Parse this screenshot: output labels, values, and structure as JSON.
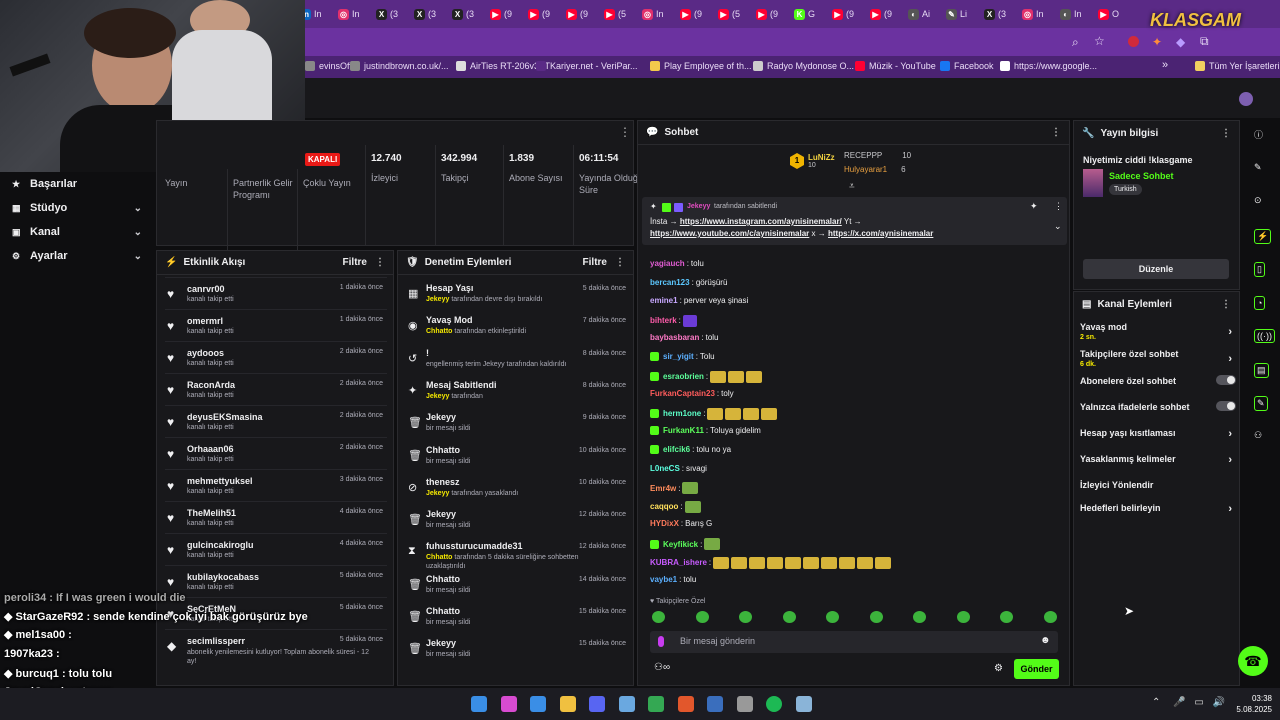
{
  "browser": {
    "tabs": [
      {
        "label": "In",
        "color": "#0a66c2",
        "glyph": "in"
      },
      {
        "label": "In",
        "color": "#e1306c",
        "glyph": "◎"
      },
      {
        "label": "(3",
        "color": "#222",
        "glyph": "X"
      },
      {
        "label": "(3",
        "color": "#222",
        "glyph": "X"
      },
      {
        "label": "(3",
        "color": "#222",
        "glyph": "X"
      },
      {
        "label": "(9",
        "color": "#ff0033",
        "glyph": "▶"
      },
      {
        "label": "(9",
        "color": "#ff0033",
        "glyph": "▶"
      },
      {
        "label": "(9",
        "color": "#ff0033",
        "glyph": "▶"
      },
      {
        "label": "(5",
        "color": "#ff0033",
        "glyph": "▶"
      },
      {
        "label": "In",
        "color": "#e1306c",
        "glyph": "◎"
      },
      {
        "label": "(9",
        "color": "#ff0033",
        "glyph": "▶"
      },
      {
        "label": "(5",
        "color": "#ff0033",
        "glyph": "▶"
      },
      {
        "label": "(9",
        "color": "#ff0033",
        "glyph": "▶"
      },
      {
        "label": "G",
        "color": "#53fc18",
        "glyph": "K"
      },
      {
        "label": "(9",
        "color": "#ff0033",
        "glyph": "▶"
      },
      {
        "label": "(9",
        "color": "#ff0033",
        "glyph": "▶"
      },
      {
        "label": "Ai",
        "color": "#555",
        "glyph": "◐"
      },
      {
        "label": "Li",
        "color": "#555",
        "glyph": "✎"
      },
      {
        "label": "(3",
        "color": "#222",
        "glyph": "X"
      },
      {
        "label": "In",
        "color": "#e1306c",
        "glyph": "◎"
      },
      {
        "label": "In",
        "color": "#555",
        "glyph": "◐"
      },
      {
        "label": "O",
        "color": "#ff0033",
        "glyph": "▶"
      }
    ],
    "bookmarks": [
      {
        "label": "evinsOff...",
        "color": "#888"
      },
      {
        "label": "justindbrown.co.uk/...",
        "color": "#888"
      },
      {
        "label": "AirTies RT-206v3TT",
        "color": "#ddd"
      },
      {
        "label": "Kariyer.net - VeriPar...",
        "color": "#5a2a86"
      },
      {
        "label": "Play Employee of th...",
        "color": "#f2c94c"
      },
      {
        "label": "Radyo Mydonose O...",
        "color": "#ccc"
      },
      {
        "label": "Müzik - YouTube",
        "color": "#ff0033"
      },
      {
        "label": "Facebook",
        "color": "#1877f2"
      },
      {
        "label": "https://www.google...",
        "color": "#fff"
      },
      {
        "label": "Tüm Yer İşaretleri",
        "color": "#f0d060"
      }
    ],
    "overflow": "»",
    "logo": "KLASGAM"
  },
  "leftnav": {
    "items": [
      {
        "label": "Başarılar",
        "icon": "star-icon",
        "chev": ""
      },
      {
        "label": "Stüdyo",
        "icon": "studio-icon",
        "chev": "⌄"
      },
      {
        "label": "Kanal",
        "icon": "channel-icon",
        "chev": "⌄"
      },
      {
        "label": "Ayarlar",
        "icon": "gear-icon",
        "chev": "⌄"
      }
    ]
  },
  "overlay_chat": [
    {
      "text": "peroli34 : If I was green i would die",
      "color": "#aaa"
    },
    {
      "text": "◆ StarGazeR92 : sende kendine çok iyi bak görüşürüz bye",
      "color": "#fff"
    },
    {
      "text": "◆ mel1sa00 :",
      "color": "#fff"
    },
    {
      "text": "1907ka23 :",
      "color": "#fff"
    },
    {
      "text": "◆ burcuq1 : tolu tolu",
      "color": "#fff"
    },
    {
      "text": "JawelCrawl : wtcnnn",
      "color": "#fff"
    }
  ],
  "stats": {
    "status": "KAPALI",
    "items": [
      {
        "value": "",
        "label": "Yayın"
      },
      {
        "value": "",
        "label": "Partnerlik Gelir Programı"
      },
      {
        "value": "",
        "label": "Çoklu Yayın"
      },
      {
        "value": "12.740",
        "label": "İzleyici"
      },
      {
        "value": "342.994",
        "label": "Takipçi"
      },
      {
        "value": "1.839",
        "label": "Abone Sayısı"
      },
      {
        "value": "06:11:54",
        "label": "Yayında Olduğu Süre"
      }
    ]
  },
  "activity": {
    "title": "Etkinlik Akışı",
    "filter": "Filtre",
    "items": [
      {
        "name": "canrvr00",
        "sub": "kanalı takip etti",
        "time": "1 dakika önce"
      },
      {
        "name": "omermrl",
        "sub": "kanalı takip etti",
        "time": "1 dakika önce"
      },
      {
        "name": "aydooos",
        "sub": "kanalı takip etti",
        "time": "2 dakika önce"
      },
      {
        "name": "RaconArda",
        "sub": "kanalı takip etti",
        "time": "2 dakika önce"
      },
      {
        "name": "deyusEKSmasina",
        "sub": "kanalı takip etti",
        "time": "2 dakika önce"
      },
      {
        "name": "Orhaaan06",
        "sub": "kanalı takip etti",
        "time": "2 dakika önce"
      },
      {
        "name": "mehmettyuksel",
        "sub": "kanalı takip etti",
        "time": "3 dakika önce"
      },
      {
        "name": "TheMelih51",
        "sub": "kanalı takip etti",
        "time": "4 dakika önce"
      },
      {
        "name": "gulcincakiroglu",
        "sub": "kanalı takip etti",
        "time": "4 dakika önce"
      },
      {
        "name": "kubilaykocabass",
        "sub": "kanalı takip etti",
        "time": "5 dakika önce"
      },
      {
        "name": "SeCrEtMeN",
        "sub": "kanalı takip etti",
        "time": "5 dakika önce"
      },
      {
        "name": "secimlissperr",
        "sub": "abonelik yenilemesini kutluyor! Toplam abonelik süresi - 12 ay!",
        "time": "5 dakika önce"
      }
    ]
  },
  "moderation": {
    "title": "Denetim Eylemleri",
    "filter": "Filtre",
    "items": [
      {
        "icon": "calendar-icon",
        "glyph": "▦",
        "name": "Hesap Yaşı",
        "user": "Jekeyy",
        "sub": "tarafından devre dışı bırakıldı",
        "time": "5 dakika önce"
      },
      {
        "icon": "snail-icon",
        "glyph": "◉",
        "name": "Yavaş Mod",
        "user": "Chhatto",
        "sub": "tarafından etkinleştirildi",
        "time": "7 dakika önce"
      },
      {
        "icon": "undo-icon",
        "glyph": "↺",
        "name": "!",
        "user": "",
        "sub": "engellenmiş terim Jekeyy tarafından kaldırıldı",
        "time": "8 dakika önce"
      },
      {
        "icon": "pin-icon",
        "glyph": "✦",
        "name": "Mesaj Sabitlendi",
        "user": "Jekeyy",
        "sub": "tarafından",
        "time": "8 dakika önce"
      },
      {
        "icon": "trash-icon",
        "glyph": "🗑",
        "name": "Jekeyy",
        "user": "",
        "sub": "bir mesajı sildi",
        "time": "9 dakika önce"
      },
      {
        "icon": "trash-icon",
        "glyph": "🗑",
        "name": "Chhatto",
        "user": "",
        "sub": "bir mesajı sildi",
        "time": "10 dakika önce"
      },
      {
        "icon": "ban-icon",
        "glyph": "⊘",
        "name": "thenesz",
        "user": "Jekeyy",
        "sub": "tarafından yasaklandı",
        "time": "10 dakika önce"
      },
      {
        "icon": "trash-icon",
        "glyph": "🗑",
        "name": "Jekeyy",
        "user": "",
        "sub": "bir mesajı sildi",
        "time": "12 dakika önce"
      },
      {
        "icon": "timer-icon",
        "glyph": "⧗",
        "name": "fuhussturucumadde31",
        "user": "Chhatto",
        "sub": "tarafından 5 dakika süreliğine sohbetten uzaklaştırıldı",
        "time": "12 dakika önce"
      },
      {
        "icon": "trash-icon",
        "glyph": "🗑",
        "name": "Chhatto",
        "user": "",
        "sub": "bir mesajı sildi",
        "time": "14 dakika önce"
      },
      {
        "icon": "trash-icon",
        "glyph": "🗑",
        "name": "Chhatto",
        "user": "",
        "sub": "bir mesajı sildi",
        "time": "15 dakika önce"
      },
      {
        "icon": "trash-icon",
        "glyph": "🗑",
        "name": "Jekeyy",
        "user": "",
        "sub": "bir mesajı sildi",
        "time": "15 dakika önce"
      }
    ]
  },
  "chat": {
    "title": "Sohbet",
    "leaders": [
      {
        "rank": "1",
        "name": "LuNiZz",
        "count": "10"
      },
      {
        "name": "RECEPPP",
        "count": "10"
      },
      {
        "name": "Hulyayarar1",
        "count": "6"
      }
    ],
    "pinned": {
      "by": "Jekeyy",
      "by_suffix": "tarafından sabitlendi",
      "line1_prefix": "İnsta →",
      "link1": "https://www.instagram.com/aynisinemalar/",
      "line1_suffix": "Yt →",
      "link2": "https://www.youtube.com/c/aynisinemalar",
      "mid": "x →",
      "link3": "https://x.com/aynisinemalar"
    },
    "messages": [
      {
        "user": "yagiauch",
        "color": "#e05cd2",
        "text": "tolu",
        "emotes": 0
      },
      {
        "user": "bercan123",
        "color": "#5cc8ff",
        "text": "görüşürü",
        "emotes": 0
      },
      {
        "user": "emine1",
        "color": "#c8a8ff",
        "text": "perver veya şinasi",
        "emotes": 0
      },
      {
        "user": "bihterk",
        "color": "#ff5cab",
        "text": "",
        "emotes": 1,
        "emoteType": "p"
      },
      {
        "user": "baybasbaran",
        "color": "#ff7ac8",
        "text": "tolu",
        "emotes": 0
      },
      {
        "user": "sir_yigit",
        "color": "#5cb0ff",
        "text": "Tolu",
        "emotes": 0
      },
      {
        "user": "esraobrien",
        "color": "#5cff9a",
        "text": "",
        "emotes": 3
      },
      {
        "user": "FurkanCaptain23",
        "color": "#ff5c5c",
        "text": "toly",
        "emotes": 0
      },
      {
        "user": "herm1one",
        "color": "#5cffc8",
        "text": "",
        "emotes": 4
      },
      {
        "user": "FurkanK11",
        "color": "#5cff5c",
        "text": "Toluya gidelim",
        "emotes": 0
      },
      {
        "user": "elifcik6",
        "color": "#5cff9a",
        "text": "tolu no ya",
        "emotes": 0
      },
      {
        "user": "L0neCS",
        "color": "#5cffe0",
        "text": "sıvagi",
        "emotes": 0
      },
      {
        "user": "Emr4w",
        "color": "#ff8c5c",
        "text": "",
        "emotes": 1,
        "emoteType": "g"
      },
      {
        "user": "caqqoo",
        "color": "#ffe05c",
        "text": "",
        "emotes": 1,
        "emoteType": "g"
      },
      {
        "user": "HYDixX",
        "color": "#ff7a5c",
        "text": "Barış G",
        "emotes": 0
      },
      {
        "user": "Keyfikick",
        "color": "#5cff5c",
        "text": "",
        "emotes": 1,
        "emoteType": "g"
      },
      {
        "user": "KUBRA_ishere",
        "color": "#c85cff",
        "text": "",
        "emotes": 10
      },
      {
        "user": "vaybe1",
        "color": "#5cb0ff",
        "text": "tolu",
        "emotes": 0
      }
    ],
    "followers_only": "Takipçilere Özel",
    "input_placeholder": "Bir mesaj gönderin",
    "send": "Gönder"
  },
  "stream_info": {
    "title": "Yayın bilgisi",
    "stream_title": "Niyetimiz ciddi !klasgame",
    "category": "Sadece Sohbet",
    "tag": "Turkish",
    "edit": "Düzenle"
  },
  "channel_actions": {
    "title": "Kanal Eylemleri",
    "items": [
      {
        "label": "Yavaş mod",
        "sub": "2 sn.",
        "control": "arrow"
      },
      {
        "label": "Takipçilere özel sohbet",
        "sub": "6 dk.",
        "control": "arrow"
      },
      {
        "label": "Abonelere özel sohbet",
        "sub": "",
        "control": "toggle"
      },
      {
        "label": "Yalnızca ifadelerle sohbet",
        "sub": "",
        "control": "toggle"
      },
      {
        "label": "Hesap yaşı kısıtlaması",
        "sub": "",
        "control": "arrow"
      },
      {
        "label": "Yasaklanmış kelimeler",
        "sub": "",
        "control": "arrow"
      },
      {
        "label": "İzleyici Yönlendir",
        "sub": "",
        "control": "none"
      },
      {
        "label": "Hedefleri belirleyin",
        "sub": "",
        "control": "arrow"
      }
    ]
  },
  "taskbar": {
    "time": "03:38",
    "date": "5.08.2025"
  },
  "colors": {
    "accent": "#53fc18",
    "mod_user": "#f5e900",
    "panel": "#18181b",
    "bg": "#0e0e10"
  }
}
